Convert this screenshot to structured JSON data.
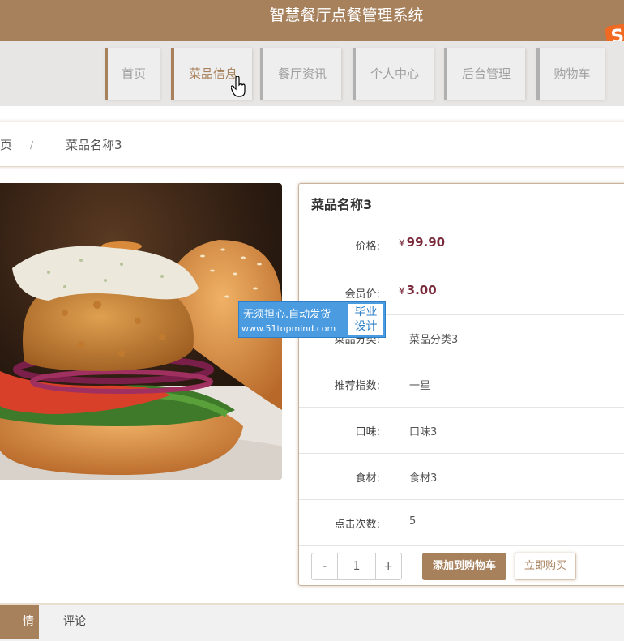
{
  "app": {
    "title": "智慧餐厅点餐管理系统"
  },
  "nav": {
    "items": [
      {
        "label": "首页"
      },
      {
        "label": "菜品信息"
      },
      {
        "label": "餐厅资讯"
      },
      {
        "label": "个人中心"
      },
      {
        "label": "后台管理"
      },
      {
        "label": "购物车"
      }
    ]
  },
  "breadcrumb": {
    "home": "页",
    "separator": "/",
    "current": "菜品名称3"
  },
  "dish": {
    "title": "菜品名称3",
    "currency": "¥",
    "price_label": "价格:",
    "price": "99.90",
    "member_price_label": "会员价:",
    "member_price": "3.00",
    "category_label": "菜品分类:",
    "category": "菜品分类3",
    "recommend_label": "推荐指数:",
    "recommend": "一星",
    "taste_label": "口味:",
    "taste": "口味3",
    "ingredient_label": "食材:",
    "ingredient": "食材3",
    "clicks_label": "点击次数:",
    "clicks": "5"
  },
  "quantity": {
    "minus": "-",
    "value": "1",
    "plus": "+"
  },
  "actions": {
    "add_to_cart": "添加到购物车",
    "buy_now": "立即购买"
  },
  "watermark": {
    "line1": "无须担心.自动发货",
    "line2": "www.51topmind.com",
    "badge_line1": "毕业",
    "badge_line2": "设计"
  },
  "tabs": {
    "detail": "详情",
    "comment": "评论"
  },
  "colors": {
    "brand": "#a7805c",
    "price": "#7a2a3a"
  }
}
